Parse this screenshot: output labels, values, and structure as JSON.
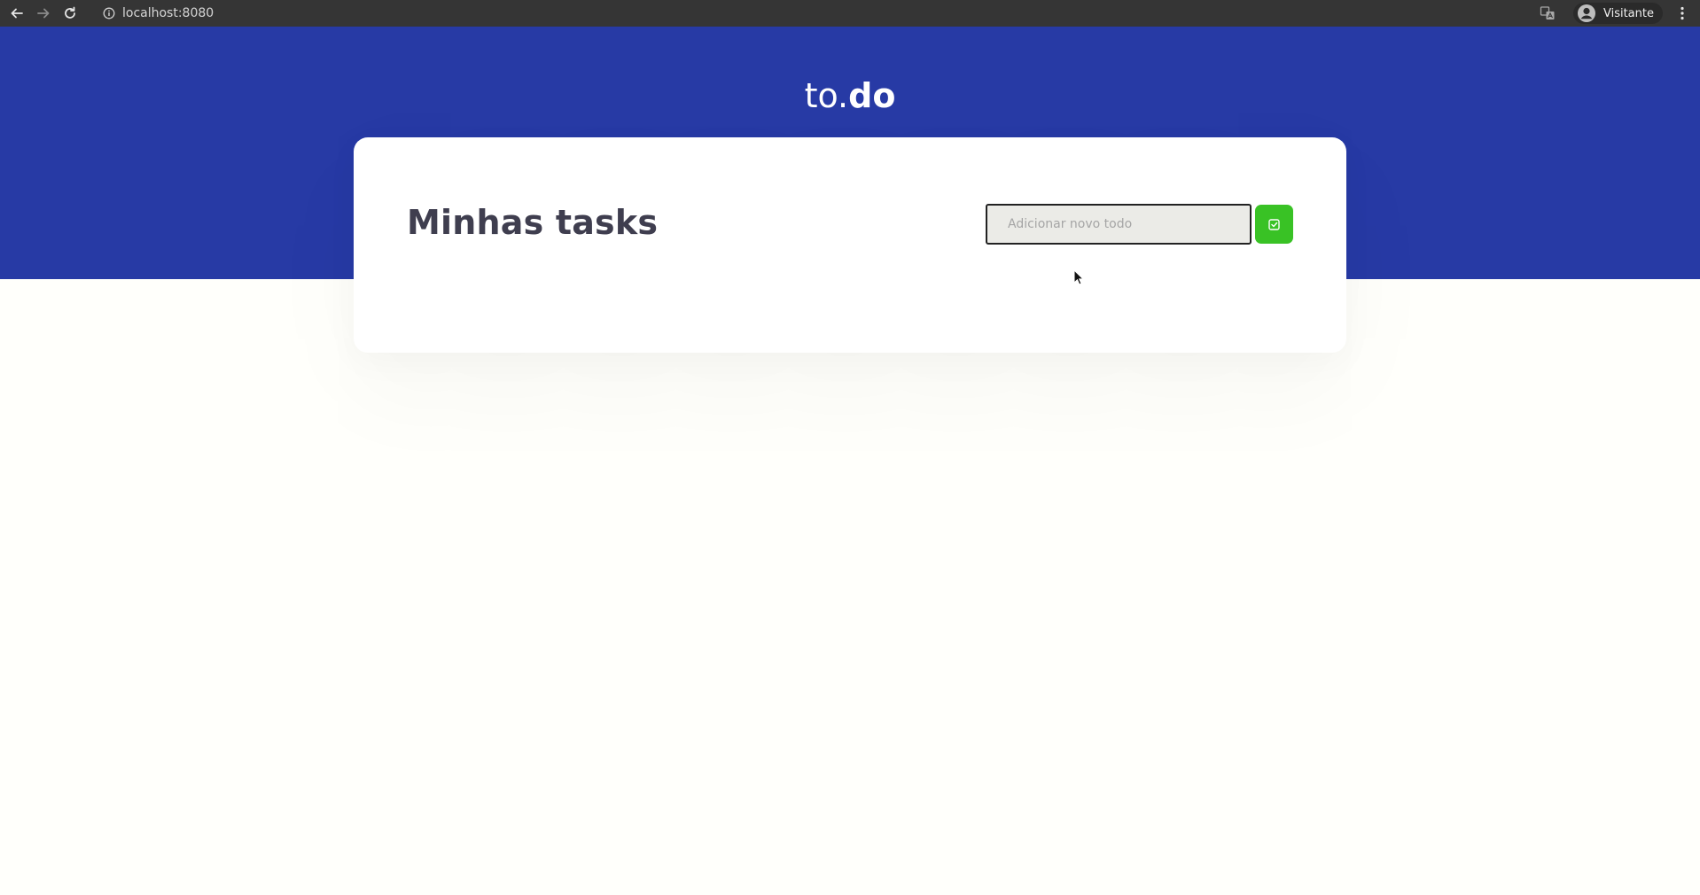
{
  "browser": {
    "url": "localhost:8080",
    "profile_name": "Visitante",
    "icons": [
      "back-arrow-icon",
      "forward-arrow-icon",
      "reload-icon",
      "info-icon",
      "translate-icon",
      "account-icon",
      "more-vert-icon"
    ]
  },
  "app": {
    "logo_light": "to.",
    "logo_bold": "do",
    "title": "Minhas tasks",
    "input": {
      "placeholder": "Adicionar novo todo",
      "value": ""
    },
    "add_button_icon": "checkbox-add-icon",
    "colors": {
      "header_bg": "#273aa5",
      "page_bg": "#fffffb",
      "card_bg": "#ffffff",
      "title_text": "#3f3e4f",
      "add_button": "#39c225",
      "input_bg": "#ebebe7"
    }
  }
}
